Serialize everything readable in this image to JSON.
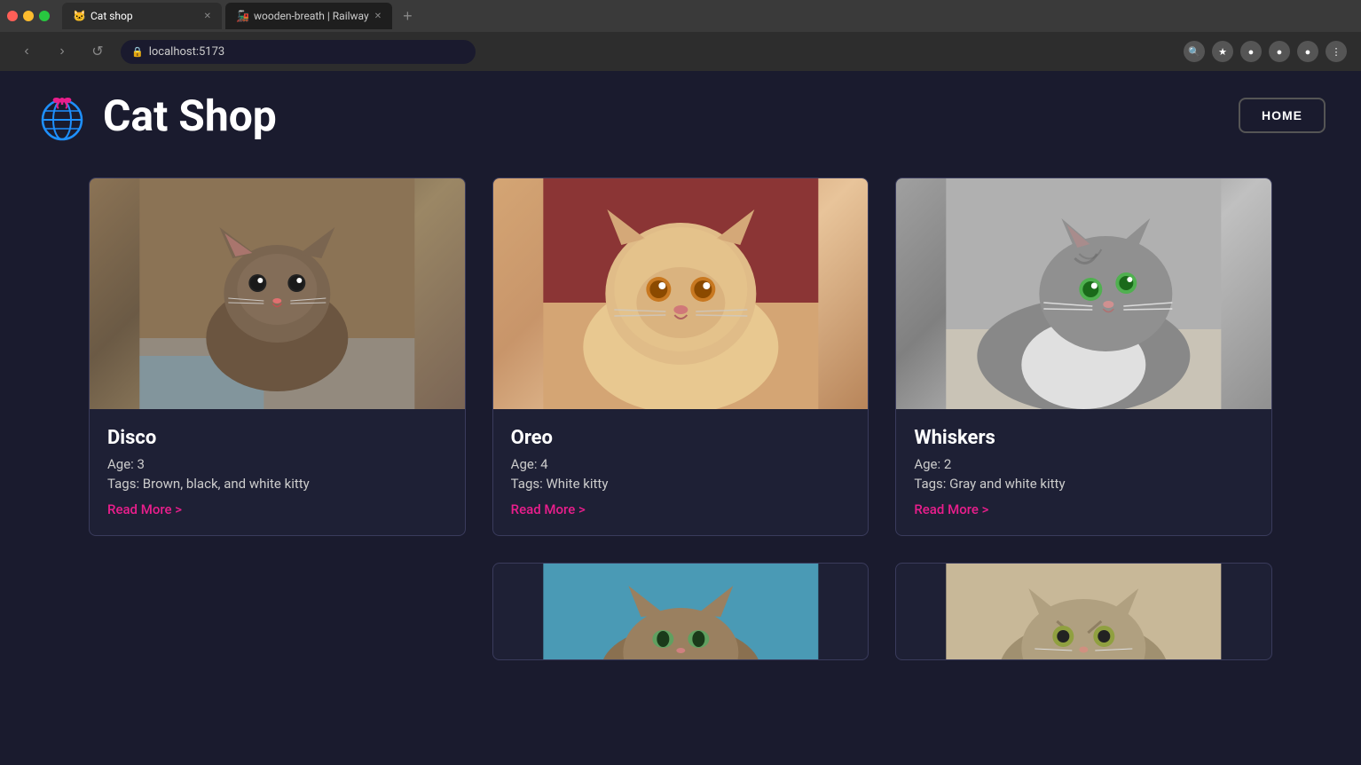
{
  "browser": {
    "tabs": [
      {
        "label": "Cat shop",
        "url": "localhost:5173",
        "active": true,
        "favicon": "🐱"
      },
      {
        "label": "wooden-breath | Railway",
        "active": false,
        "favicon": "🚂"
      }
    ],
    "address": "localhost:5173",
    "add_tab_label": "+"
  },
  "header": {
    "title": "Cat Shop",
    "home_button": "HOME",
    "logo_alt": "Cat shop logo"
  },
  "cats": [
    {
      "name": "Disco",
      "age_label": "Age: 3",
      "tags_label": "Tags: Brown, black, and white kitty",
      "read_more": "Read More >",
      "img_class": "cat-img-1"
    },
    {
      "name": "Oreo",
      "age_label": "Age: 4",
      "tags_label": "Tags: White kitty",
      "read_more": "Read More >",
      "img_class": "cat-img-2"
    },
    {
      "name": "Whiskers",
      "age_label": "Age: 2",
      "tags_label": "Tags: Gray and white kitty",
      "read_more": "Read More >",
      "img_class": "cat-img-3"
    }
  ],
  "bottom_cards": [
    {
      "img_class": "cat-img-bottom-1"
    },
    {
      "img_class": "cat-img-bottom-2"
    }
  ],
  "nav": {
    "back": "‹",
    "forward": "›",
    "refresh": "↺"
  }
}
